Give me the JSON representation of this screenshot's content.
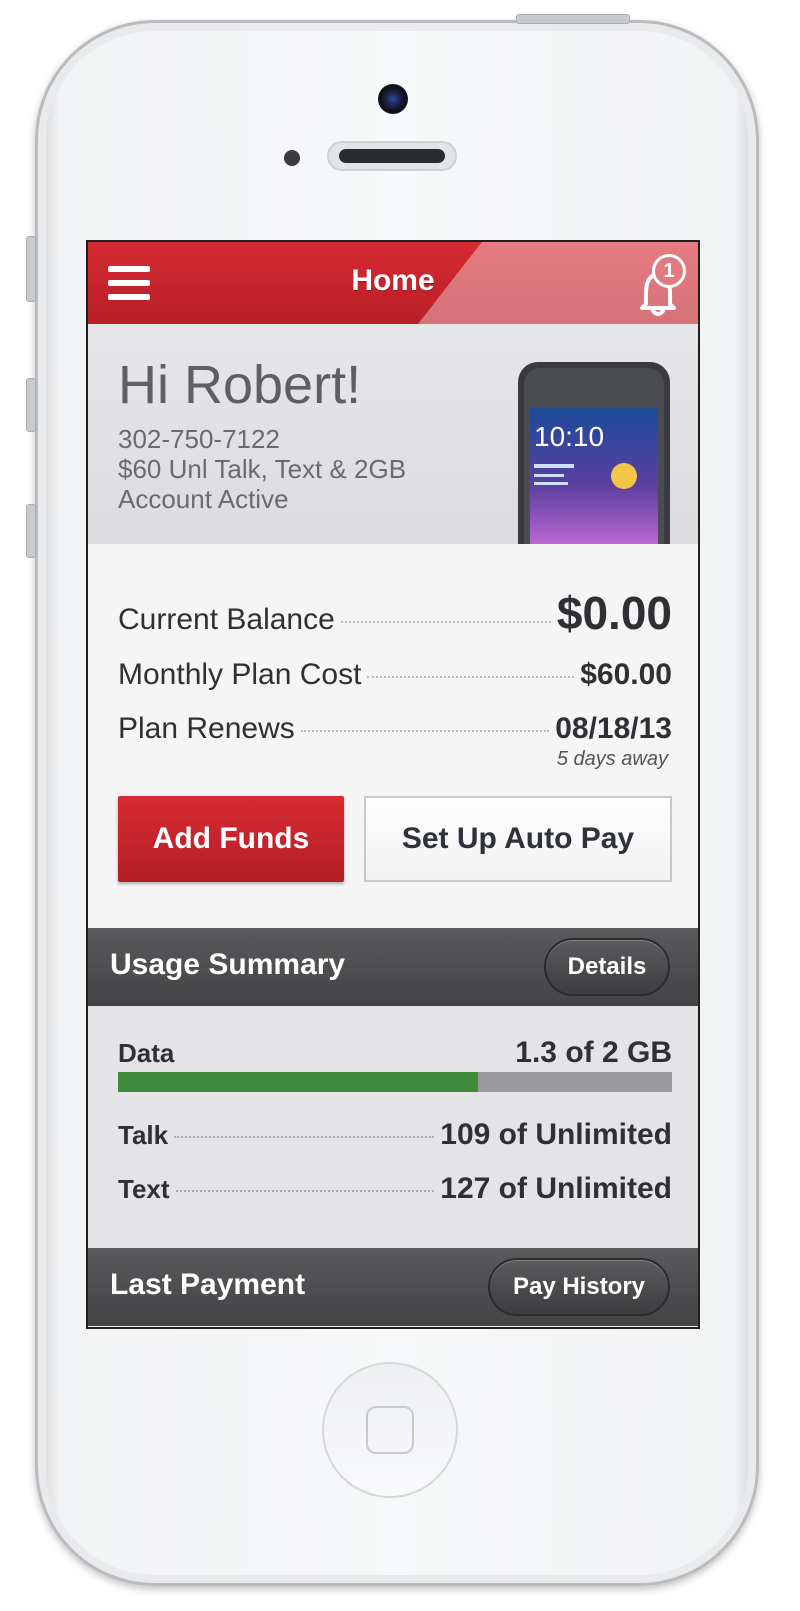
{
  "header": {
    "title": "Home",
    "notification_count": "1"
  },
  "account": {
    "greeting": "Hi Robert!",
    "phone_number": "302-750-7122",
    "plan": "$60 Unl Talk, Text & 2GB",
    "status": "Account Active",
    "device_time": "10:10"
  },
  "balances": {
    "current_balance_label": "Current Balance",
    "current_balance_value": "$0.00",
    "monthly_cost_label": "Monthly Plan Cost",
    "monthly_cost_value": "$60.00",
    "renews_label": "Plan Renews",
    "renews_value": "08/18/13",
    "renews_note": "5 days away"
  },
  "actions": {
    "add_funds": "Add Funds",
    "auto_pay": "Set Up Auto Pay"
  },
  "usage": {
    "title": "Usage Summary",
    "details_button": "Details",
    "data_label": "Data",
    "data_value": "1.3 of 2 GB",
    "data_used_fraction": 0.65,
    "talk_label": "Talk",
    "talk_value": "109 of Unlimited",
    "text_label": "Text",
    "text_value": "127 of Unlimited"
  },
  "last_payment": {
    "title": "Last Payment",
    "history_button": "Pay History"
  },
  "colors": {
    "brand_red": "#cd262e",
    "usage_green": "#3f8a3b",
    "section_dark": "#4a4a4c"
  }
}
